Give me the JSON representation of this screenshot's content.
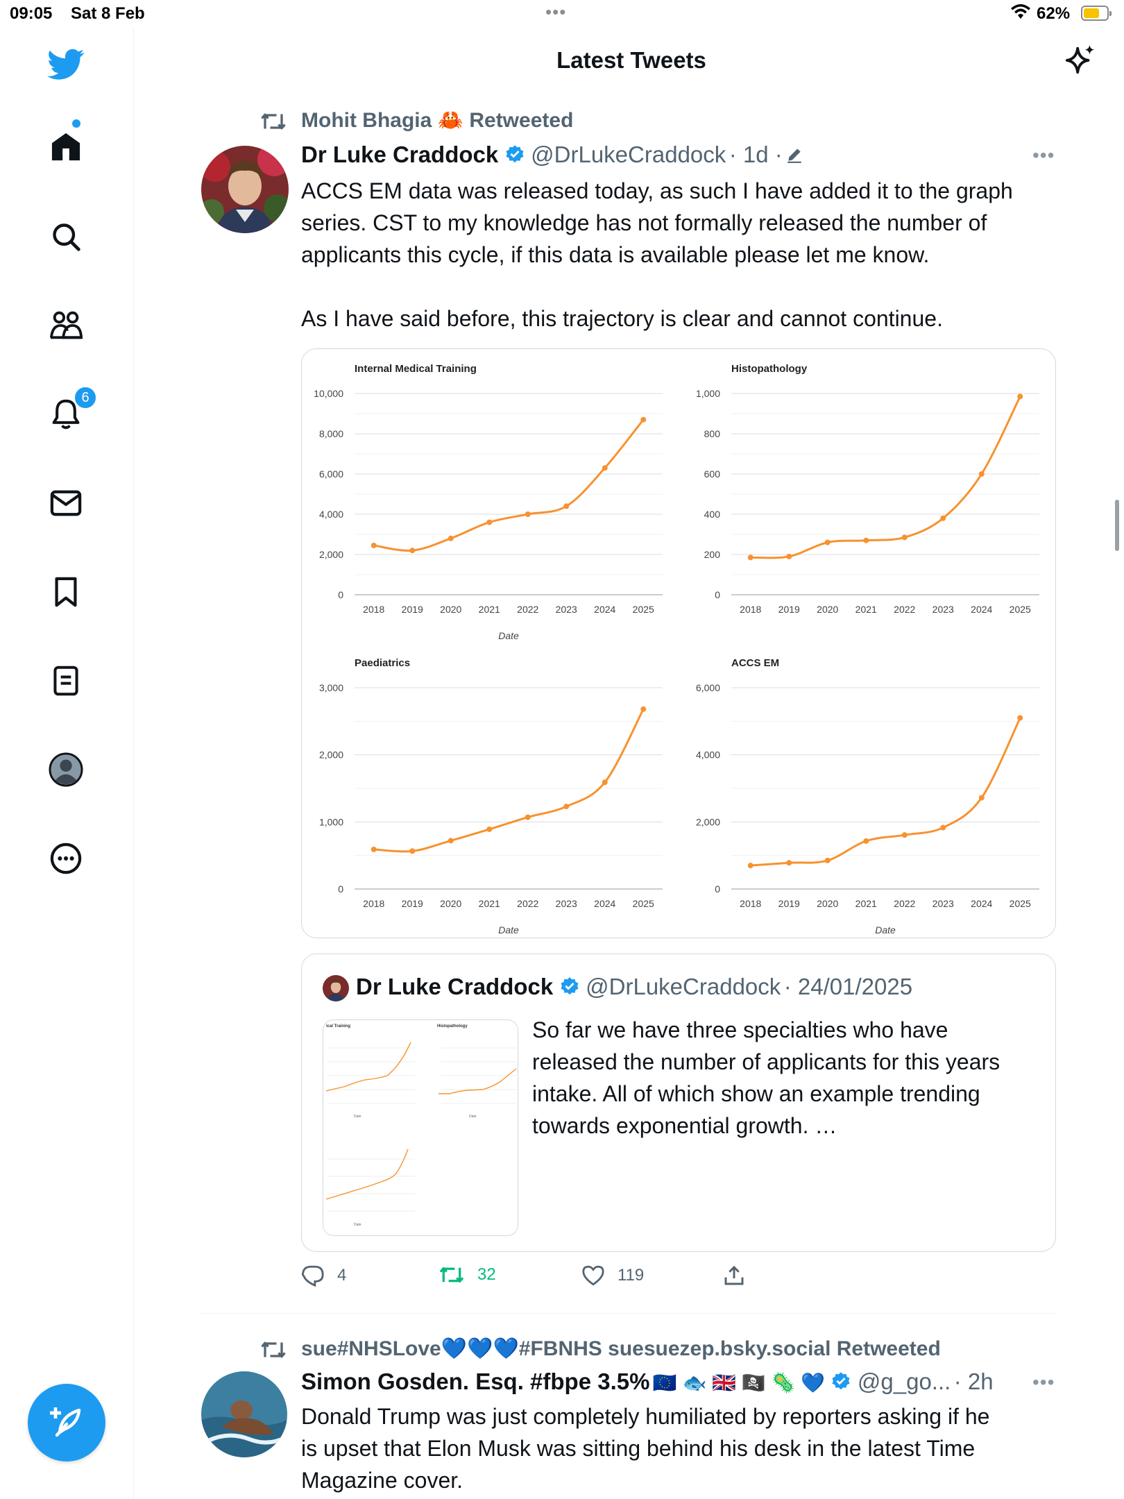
{
  "status_bar": {
    "time": "09:05",
    "date": "Sat 8 Feb",
    "battery": "62%"
  },
  "header": {
    "title": "Latest Tweets"
  },
  "nav": {
    "notifications_badge": "6"
  },
  "tweet1": {
    "social_context": "Mohit Bhagia 🦀 Retweeted",
    "author_name": "Dr Luke Craddock",
    "handle": "@DrLukeCraddock",
    "time": "· 1d ·",
    "text_lines": [
      "ACCS EM data was released today, as such I have added it to the graph",
      "series. CST to my knowledge has not formally released the number of",
      "applicants this cycle, if this data is available please let me know.",
      "As I have said before, this trajectory is clear and cannot continue."
    ],
    "quote": {
      "author_name": "Dr Luke Craddock",
      "handle": "@DrLukeCraddock",
      "date": "· 24/01/2025",
      "text_lines": [
        "So far we have three specialties who have",
        "released the number of applicants for this years",
        "intake. All of which show an example trending",
        "towards exponential growth. …"
      ]
    },
    "actions": {
      "replies": "4",
      "retweets": "32",
      "likes": "119"
    }
  },
  "tweet2": {
    "social_context": "sue#NHSLove💙💙💙#FBNHS suesuezep.bsky.social Retweeted",
    "author_name": "Simon Gosden. Esq. #fbpe 3.5%",
    "author_emojis": "🇪🇺 🐟 🇬🇧 🏴‍☠️ 🦠 💙",
    "handle": "@g_go...",
    "time": "· 2h",
    "text_lines": [
      "Donald Trump was just completely humiliated by reporters asking if he",
      "is upset that Elon Musk was sitting behind his desk in the latest Time",
      "Magazine cover."
    ]
  },
  "chart_data": [
    {
      "type": "line",
      "title": "Internal Medical Training",
      "xlabel": "Date",
      "ylabel": "",
      "x": [
        "2018",
        "2019",
        "2020",
        "2021",
        "2022",
        "2023",
        "2024",
        "2025"
      ],
      "values": [
        2450,
        2200,
        2800,
        3600,
        4000,
        4400,
        6300,
        8700
      ],
      "ylim": [
        0,
        10000
      ],
      "yticks": [
        "10,000",
        "8,000",
        "6,000",
        "4,000",
        "2,000",
        "0"
      ],
      "color": "#f7922f"
    },
    {
      "type": "line",
      "title": "Histopathology",
      "xlabel": "",
      "ylabel": "",
      "x": [
        "2018",
        "2019",
        "2020",
        "2021",
        "2022",
        "2023",
        "2024",
        "2025"
      ],
      "values": [
        185,
        190,
        260,
        270,
        285,
        380,
        600,
        985
      ],
      "ylim": [
        0,
        1000
      ],
      "yticks": [
        "1,000",
        "800",
        "600",
        "400",
        "200",
        "0"
      ],
      "color": "#f7922f"
    },
    {
      "type": "line",
      "title": "Paediatrics",
      "xlabel": "Date",
      "ylabel": "",
      "x": [
        "2018",
        "2019",
        "2020",
        "2021",
        "2022",
        "2023",
        "2024",
        "2025"
      ],
      "values": [
        590,
        565,
        720,
        890,
        1070,
        1230,
        1590,
        2680
      ],
      "ylim": [
        0,
        3000
      ],
      "yticks": [
        "3,000",
        "2,000",
        "1,000",
        "0"
      ],
      "color": "#f7922f"
    },
    {
      "type": "line",
      "title": "ACCS EM",
      "xlabel": "Date",
      "ylabel": "",
      "x": [
        "2018",
        "2019",
        "2020",
        "2021",
        "2022",
        "2023",
        "2024",
        "2025"
      ],
      "values": [
        700,
        780,
        850,
        1430,
        1610,
        1830,
        2720,
        5100
      ],
      "ylim": [
        0,
        6000
      ],
      "yticks": [
        "6,000",
        "4,000",
        "2,000",
        "0"
      ],
      "color": "#f7922f"
    }
  ]
}
